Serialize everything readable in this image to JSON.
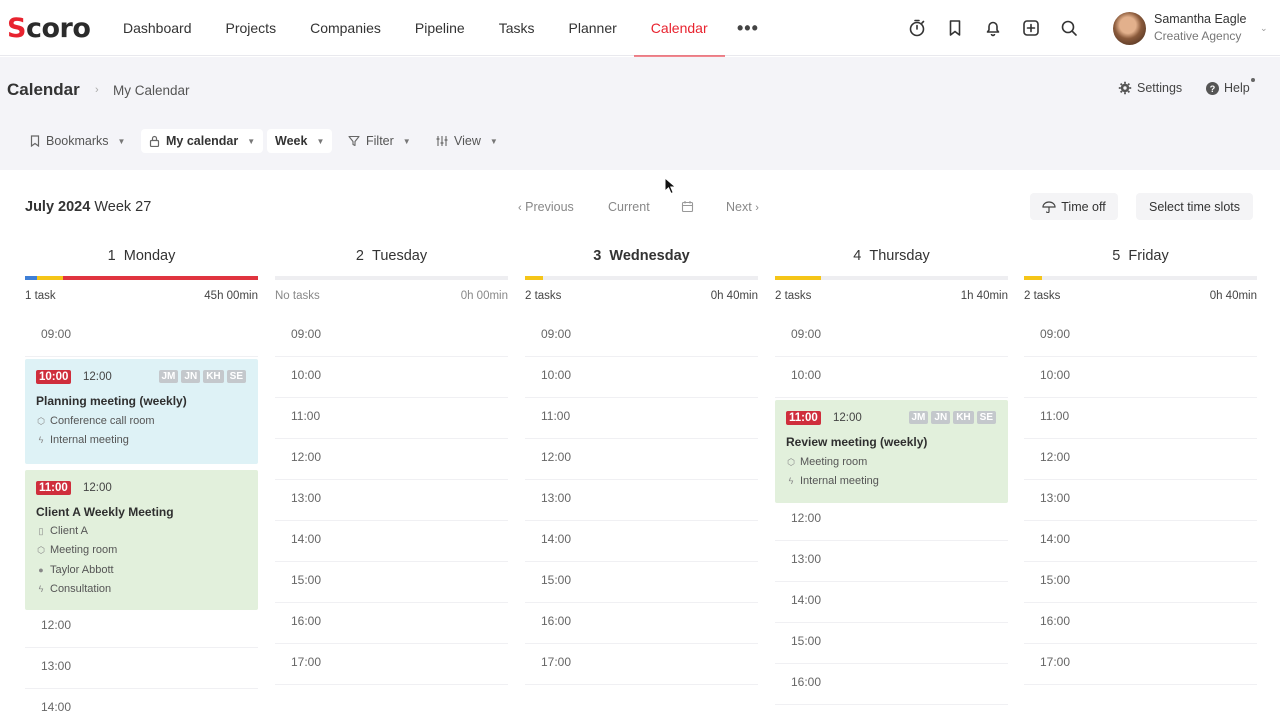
{
  "nav": {
    "logo": "Scoro",
    "items": [
      "Dashboard",
      "Projects",
      "Companies",
      "Pipeline",
      "Tasks",
      "Planner",
      "Calendar"
    ],
    "active": "Calendar",
    "more": "•••",
    "icons": [
      "timer-icon",
      "bookmark-icon",
      "bell-icon",
      "add-icon",
      "search-icon"
    ],
    "user": {
      "name": "Samantha Eagle",
      "org": "Creative Agency"
    }
  },
  "header": {
    "title": "Calendar",
    "crumb_sep": "›",
    "subtitle": "My Calendar",
    "settings": "Settings",
    "help": "Help"
  },
  "toolbar": {
    "bookmarks": "Bookmarks",
    "calendar": "My calendar",
    "range": "Week",
    "filter": "Filter",
    "view": "View"
  },
  "week": {
    "month": "July 2024",
    "week": "Week 27",
    "previous": "Previous",
    "current": "Current",
    "next": "Next",
    "time_off": "Time off",
    "select_slots": "Select time slots"
  },
  "days": [
    {
      "num": "1",
      "name": "Monday",
      "count": "1 task",
      "duration": "45h 00min",
      "slots_before": [
        "09:00"
      ],
      "slots_after": [
        "12:00",
        "13:00",
        "14:00"
      ]
    },
    {
      "num": "2",
      "name": "Tuesday",
      "count": "No tasks",
      "duration": "0h 00min",
      "slots": [
        "09:00",
        "10:00",
        "11:00",
        "12:00",
        "13:00",
        "14:00",
        "15:00",
        "16:00",
        "17:00"
      ]
    },
    {
      "num": "3",
      "name": "Wednesday",
      "count": "2 tasks",
      "duration": "0h 40min",
      "slots": [
        "09:00",
        "10:00",
        "11:00",
        "12:00",
        "13:00",
        "14:00",
        "15:00",
        "16:00",
        "17:00"
      ]
    },
    {
      "num": "4",
      "name": "Thursday",
      "count": "2 tasks",
      "duration": "1h 40min",
      "slots_before": [
        "09:00",
        "10:00"
      ],
      "slots_after": [
        "12:00",
        "13:00",
        "14:00",
        "15:00",
        "16:00"
      ]
    },
    {
      "num": "5",
      "name": "Friday",
      "count": "2 tasks",
      "duration": "0h 40min",
      "slots": [
        "09:00",
        "10:00",
        "11:00",
        "12:00",
        "13:00",
        "14:00",
        "15:00",
        "16:00",
        "17:00"
      ]
    }
  ],
  "events": {
    "planning": {
      "start": "10:00",
      "end": "12:00",
      "tags": [
        "JM",
        "JN",
        "KH",
        "SE"
      ],
      "title": "Planning meeting (weekly)",
      "room": "Conference call room",
      "type": "Internal meeting"
    },
    "client": {
      "start": "11:00",
      "end": "12:00",
      "title": "Client A Weekly Meeting",
      "company": "Client A",
      "room": "Meeting room",
      "person": "Taylor Abbott",
      "type": "Consultation"
    },
    "review": {
      "start": "11:00",
      "end": "12:00",
      "tags": [
        "JM",
        "JN",
        "KH",
        "SE"
      ],
      "title": "Review meeting (weekly)",
      "room": "Meeting room",
      "type": "Internal meeting"
    }
  },
  "colors": {
    "accent": "#e8232f",
    "event_blue": "#def2f6",
    "event_green": "#e2f0dc",
    "time_badge": "#cf2e3c",
    "bar_yellow": "#f5c518",
    "bar_blue": "#3f7fd6",
    "bar_red": "#e0343f"
  }
}
